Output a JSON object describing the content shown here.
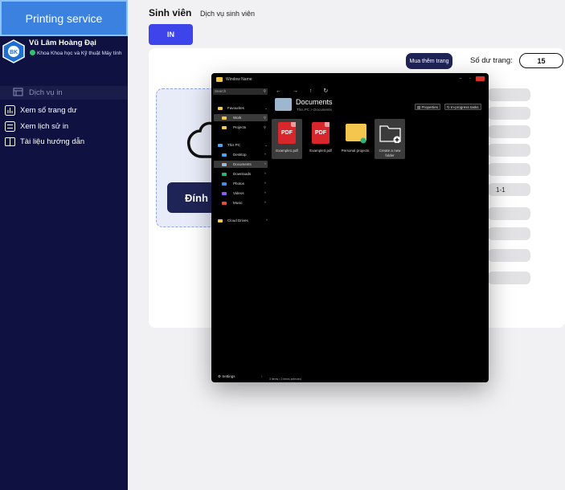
{
  "app": {
    "brand": "Printing service"
  },
  "user": {
    "name": "Vũ Lâm Hoàng Đại",
    "department": "Khoa Khoa học và Kỹ thuật Máy tính",
    "avatar_text": "BK"
  },
  "sidebar": {
    "items": [
      {
        "label": "Dịch vụ in",
        "icon": "printer-icon",
        "active": true
      },
      {
        "label": "Xem số trang dư",
        "icon": "bar-chart-icon",
        "active": false
      },
      {
        "label": "Xem lịch sử in",
        "icon": "list-icon",
        "active": false
      },
      {
        "label": "Tài liệu hướng dẫn",
        "icon": "book-icon",
        "active": false
      }
    ]
  },
  "header": {
    "title": "Sinh viên",
    "subtitle": "Dịch vụ sinh viên",
    "in_button": "IN"
  },
  "main": {
    "buy_button": "Mua thêm trang",
    "balance_label": "Số dư trang:",
    "balance_value": "15",
    "upload_button": "Đính",
    "pill_text": "1-1"
  },
  "explorer": {
    "window_title": "Window Name",
    "controls": [
      "–",
      "▫"
    ],
    "search_placeholder": "Search",
    "nav_arrows": "← → ↑ ↻",
    "tree": [
      {
        "label": "Favourites",
        "icon": "folder",
        "caret": "⌄"
      },
      {
        "label": "Work",
        "icon": "folder",
        "caret": "⚲",
        "selected": true
      },
      {
        "label": "Projects",
        "icon": "folder",
        "caret": "⚲"
      },
      {
        "label": "This PC",
        "icon": "pc",
        "caret": "⌄"
      },
      {
        "label": "Desktop",
        "icon": "desktop",
        "caret": "^"
      },
      {
        "label": "Documents",
        "icon": "documents",
        "caret": "^",
        "selected": true
      },
      {
        "label": "Downloads",
        "icon": "downloads",
        "caret": "^"
      },
      {
        "label": "Photos",
        "icon": "photos",
        "caret": "^"
      },
      {
        "label": "Videos",
        "icon": "videos",
        "caret": "^"
      },
      {
        "label": "Music",
        "icon": "music",
        "caret": "^"
      },
      {
        "label": "Cloud Drives",
        "icon": "folder",
        "caret": "^"
      }
    ],
    "location_title": "Documents",
    "location_path": "This PC  >  Documents",
    "properties_button": "Properties",
    "tasks_button": "In-progress tasks",
    "files": [
      {
        "label": "Example1.pdf",
        "type": "pdf",
        "selected": true
      },
      {
        "label": "Example3.pdf",
        "type": "pdf",
        "selected": false
      },
      {
        "label": "Personal projects",
        "type": "folder",
        "selected": false
      },
      {
        "label": "Create a new folder",
        "type": "new-folder",
        "selected": true
      }
    ],
    "file_badge": "PDF",
    "settings_label": "Settings",
    "settings_caret": "›",
    "status": "3 items  •  2 items selected"
  },
  "colors": {
    "sidebar_bg": "#0f1240",
    "brand_bg": "#3b82e0",
    "accent": "#3d45ea",
    "pdf_red": "#d7262c",
    "folder_yellow": "#f5c64e"
  }
}
